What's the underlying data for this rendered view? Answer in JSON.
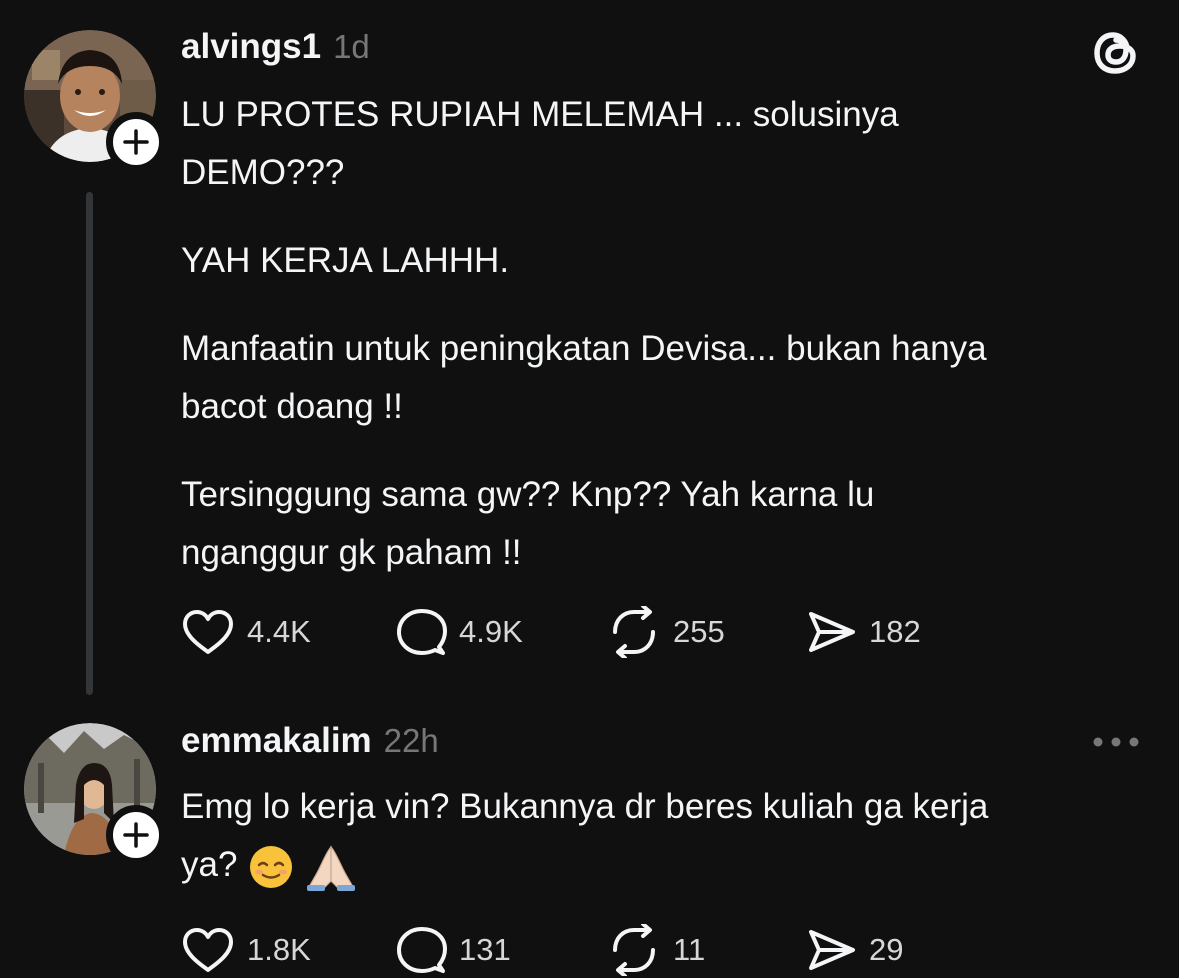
{
  "posts": [
    {
      "username": "alvings1",
      "time": "1d",
      "paragraphs": [
        [
          "LU PROTES RUPIAH MELEMAH ... solusinya",
          "DEMO???"
        ],
        [
          "YAH KERJA LAHHH."
        ],
        [
          "Manfaatin untuk peningkatan Devisa... bukan hanya",
          "bacot doang !!"
        ],
        [
          "Tersinggung sama gw?? Knp?? Yah karna lu",
          "nganggur gk paham !!"
        ]
      ],
      "actions": {
        "likes": "4.4K",
        "replies": "4.9K",
        "reposts": "255",
        "shares": "182"
      },
      "icons": {
        "avatar": "user-avatar-alvings1",
        "follow": "plus-icon",
        "brand": "threads-logo-icon"
      }
    },
    {
      "username": "emmakalim",
      "time": "22h",
      "paragraphs": [
        [
          "Emg lo kerja vin? Bukannya dr beres kuliah ga kerja",
          "ya?"
        ]
      ],
      "emojis": [
        "relieved-face-emoji",
        "folded-hands-emoji"
      ],
      "actions": {
        "likes": "1.8K",
        "replies": "131",
        "reposts": "11",
        "shares": "29"
      },
      "icons": {
        "avatar": "user-avatar-emmakalim",
        "follow": "plus-icon",
        "menu": "more-options-icon"
      }
    }
  ],
  "colors": {
    "background": "#101010",
    "text": "#f3f5f7",
    "muted": "#777777",
    "thread_line": "#333638"
  }
}
